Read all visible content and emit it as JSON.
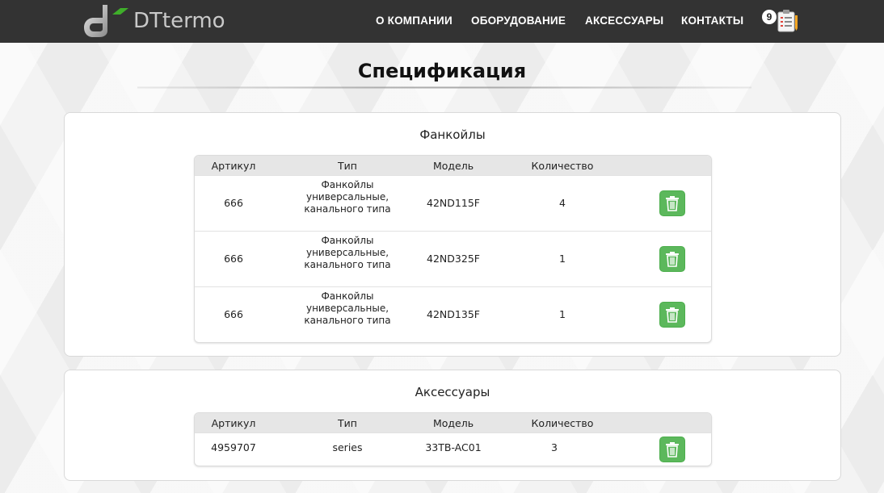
{
  "brand": {
    "name": "DTtermo"
  },
  "nav": {
    "items": [
      {
        "label": "О КОМПАНИИ"
      },
      {
        "label": "ОБОРУДОВАНИЕ"
      },
      {
        "label": "АКСЕССУАРЫ"
      },
      {
        "label": "КОНТАКТЫ"
      }
    ],
    "cart_count": "9"
  },
  "page": {
    "title": "Спецификация"
  },
  "colors": {
    "accent_green": "#5cb85c",
    "topbar": "#333333",
    "logo_green": "#3fae2a"
  },
  "headers": {
    "article": "Артикул",
    "type": "Тип",
    "model": "Модель",
    "qty": "Количество"
  },
  "sections": [
    {
      "title": "Фанкойлы",
      "rows": [
        {
          "article": "666",
          "type": "Фанкойлы универсальные, канального типа",
          "model": "42ND115F",
          "qty": "4"
        },
        {
          "article": "666",
          "type": "Фанкойлы универсальные, канального типа",
          "model": "42ND325F",
          "qty": "1"
        },
        {
          "article": "666",
          "type": "Фанкойлы универсальные, канального типа",
          "model": "42ND135F",
          "qty": "1"
        }
      ]
    },
    {
      "title": "Аксессуары",
      "rows": [
        {
          "article": "4959707",
          "type": "series",
          "model": "33TB-AC01",
          "qty": "3"
        }
      ]
    }
  ],
  "icons": {
    "delete": "trash-icon",
    "cart": "clipboard-list-icon",
    "logo": "dt-logo-icon"
  }
}
